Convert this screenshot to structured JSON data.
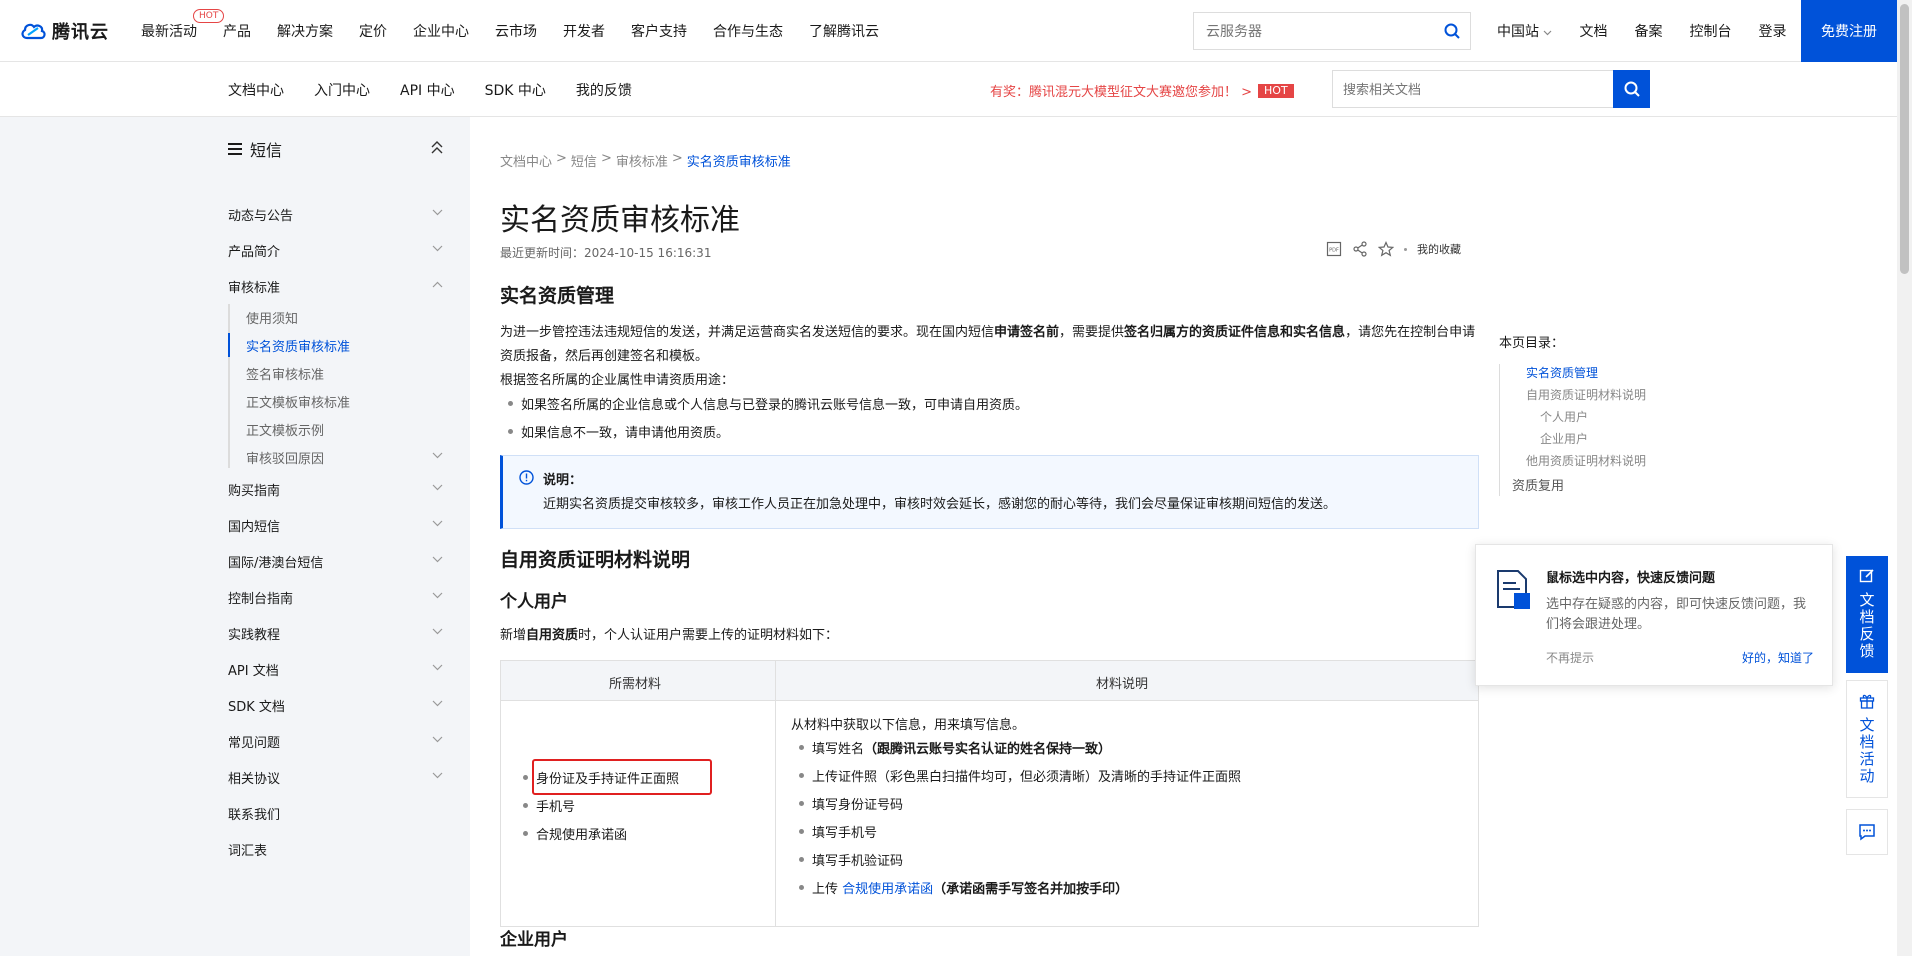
{
  "brand": {
    "name": "腾讯云"
  },
  "mainnav": {
    "items": [
      "最新活动",
      "产品",
      "解决方案",
      "定价",
      "企业中心",
      "云市场",
      "开发者",
      "客户支持",
      "合作与生态",
      "了解腾讯云"
    ],
    "hot_badge": "HOT"
  },
  "top_search": {
    "placeholder": "云服务器"
  },
  "toplinks": {
    "site": "中国站",
    "docs": "文档",
    "beian": "备案",
    "console": "控制台",
    "login": "登录",
    "register": "免费注册"
  },
  "subnav": {
    "items": [
      "文档中心",
      "入门中心",
      "API 中心",
      "SDK 中心",
      "我的反馈"
    ],
    "promo": "有奖：腾讯混元大模型征文大赛邀您参加！ >",
    "promo_badge": "HOT",
    "search_placeholder": "搜索相关文档"
  },
  "sidebar": {
    "title": "短信",
    "items": [
      "动态与公告",
      "产品简介",
      "审核标准",
      "购买指南",
      "国内短信",
      "国际/港澳台短信",
      "控制台指南",
      "实践教程",
      "API 文档",
      "SDK 文档",
      "常见问题",
      "相关协议",
      "联系我们",
      "词汇表"
    ],
    "subitems": [
      "使用须知",
      "实名资质审核标准",
      "签名审核标准",
      "正文模板审核标准",
      "正文模板示例",
      "审核驳回原因"
    ]
  },
  "breadcrumb": {
    "b1": "文档中心",
    "b2": "短信",
    "b3": "审核标准",
    "b4": "实名资质审核标准",
    "sep": ">"
  },
  "page": {
    "title": "实名资质审核标准",
    "updated": "最近更新时间：2024-10-15 16:16:31",
    "favorite": "我的收藏",
    "pdf_label": "PDF"
  },
  "section1": {
    "heading": "实名资质管理",
    "p1_a": "为进一步管控违法违规短信的发送，并满足运营商实名发送短信的要求。现在国内短信",
    "p1_b": "申请签名前",
    "p1_c": "，需要提供",
    "p1_d": "签名归属方的资质证件信息和实名信息",
    "p1_e": "，请您先在控制台申请资质报备，然后再创建签名和模板。",
    "p2": "根据签名所属的企业属性申请资质用途：",
    "bullet1": "如果签名所属的企业信息或个人信息与已登录的腾讯云账号信息一致，可申请自用资质。",
    "bullet2": "如果信息不一致，请申请他用资质。"
  },
  "note": {
    "title": "说明：",
    "body": "近期实名资质提交审核较多，审核工作人员正在加急处理中，审核时效会延长，感谢您的耐心等待，我们会尽量保证审核期间短信的发送。"
  },
  "section2": {
    "heading": "自用资质证明材料说明",
    "subheading": "个人用户",
    "intro_a": "新增",
    "intro_b": "自用资质",
    "intro_c": "时，个人认证用户需要上传的证明材料如下："
  },
  "table": {
    "col1": "所需材料",
    "col2": "材料说明",
    "materials": [
      "身份证及手持证件正面照",
      "手机号",
      "合规使用承诺函"
    ],
    "desc_intro": "从材料中获取以下信息，用来填写信息。",
    "desc1_a": "填写姓名",
    "desc1_b": "（跟腾讯云账号实名认证的姓名保持一致）",
    "desc2": "上传证件照（彩色黑白扫描件均可，但必须清晰）及清晰的手持证件正面照",
    "desc3": "填写身份证号码",
    "desc4": "填写手机号",
    "desc5": "填写手机验证码",
    "desc6_a": "上传",
    "desc6_link": "合规使用承诺函",
    "desc6_b": "（承诺函需手写签名并加按手印）"
  },
  "section3": {
    "heading": "企业用户"
  },
  "toc": {
    "title": "本页目录：",
    "items": [
      "实名资质管理",
      "自用资质证明材料说明",
      "个人用户",
      "企业用户",
      "他用资质证明材料说明",
      "资质复用"
    ]
  },
  "popup": {
    "title": "鼠标选中内容，快速反馈问题",
    "body": "选中存在疑惑的内容，即可快速反馈问题，我们将会跟进处理。",
    "skip": "不再提示",
    "ok": "好的，知道了"
  },
  "float": {
    "feedback": "文档反馈",
    "activity": "文档活动"
  },
  "colors": {
    "primary": "#0052d9",
    "hot": "#e54545",
    "highlight": "#e02020"
  }
}
